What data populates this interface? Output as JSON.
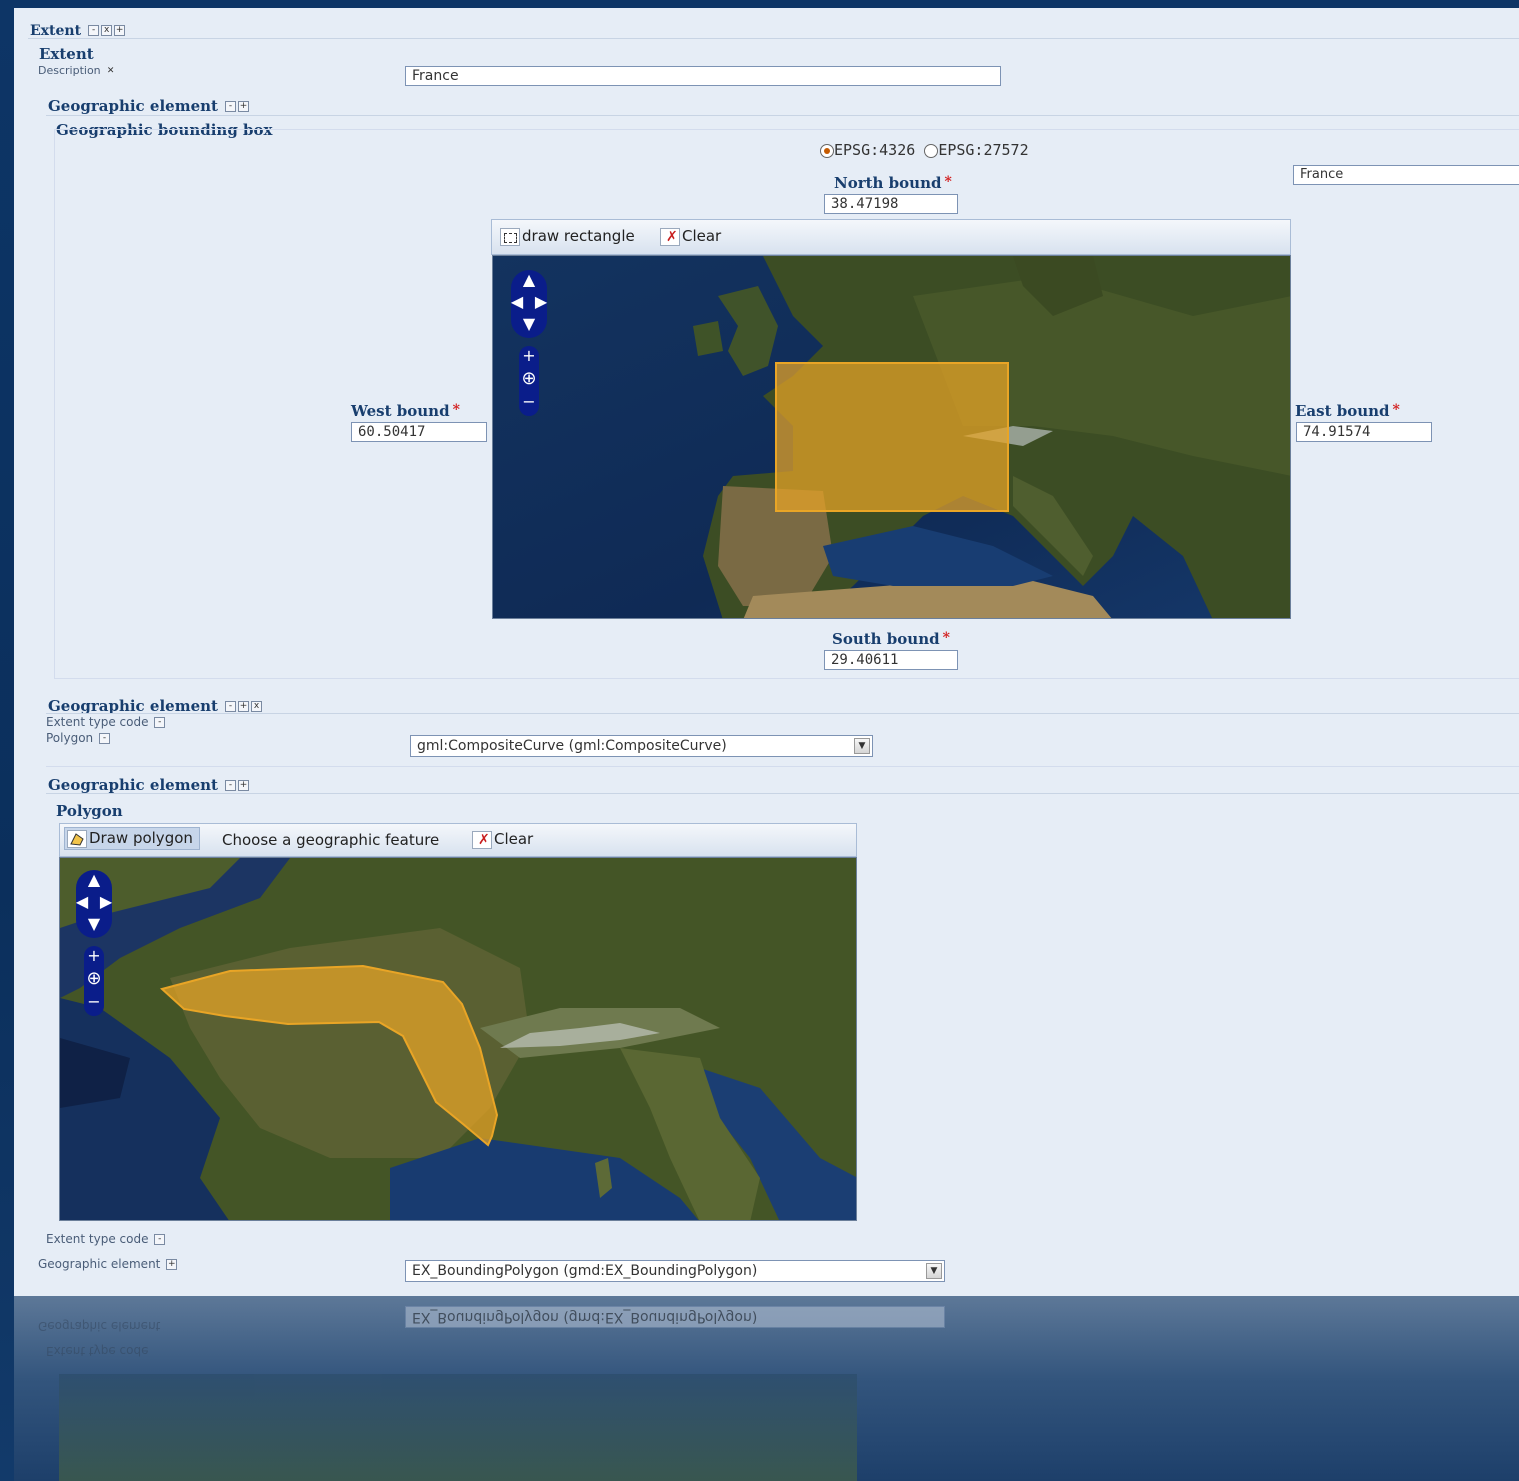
{
  "extent": {
    "header": "Extent",
    "section_title": "Extent",
    "description_label": "Description",
    "description_value": "France"
  },
  "bbox_element": {
    "header": "Geographic element",
    "subheader": "Geographic bounding box",
    "crs_options": [
      "EPSG:4326",
      "EPSG:27572"
    ],
    "crs_selected": "EPSG:4326",
    "region_value": "France",
    "north_label": "North bound",
    "north_value": "38.47198",
    "south_label": "South bound",
    "south_value": "29.40611",
    "west_label": "West bound",
    "west_value": "60.50417",
    "east_label": "East bound",
    "east_value": "74.91574",
    "toolbar": {
      "draw_label": "draw rectangle",
      "clear_label": "Clear"
    }
  },
  "type_element": {
    "header": "Geographic element",
    "extent_type_label": "Extent type code",
    "polygon_label": "Polygon",
    "polygon_select": "gml:CompositeCurve (gml:CompositeCurve)"
  },
  "polygon_element": {
    "header": "Geographic element",
    "subheader": "Polygon",
    "toolbar": {
      "draw_label": "Draw polygon",
      "choose_label": "Choose a geographic feature",
      "clear_label": "Clear"
    }
  },
  "footer": {
    "extent_type_label": "Extent type code",
    "geo_element_label": "Geographic element",
    "bounding_select": "EX_BoundingPolygon (gmd:EX_BoundingPolygon)"
  },
  "colors": {
    "highlight": "#e9a526",
    "panel_bg": "#e6edf6",
    "heading": "#183e6e"
  },
  "icons": [
    "move-up-icon",
    "move-left-icon",
    "move-right-icon",
    "move-down-icon",
    "zoom-in-icon",
    "zoom-world-icon",
    "zoom-out-icon",
    "draw-rectangle-icon",
    "clear-icon",
    "draw-polygon-icon"
  ]
}
